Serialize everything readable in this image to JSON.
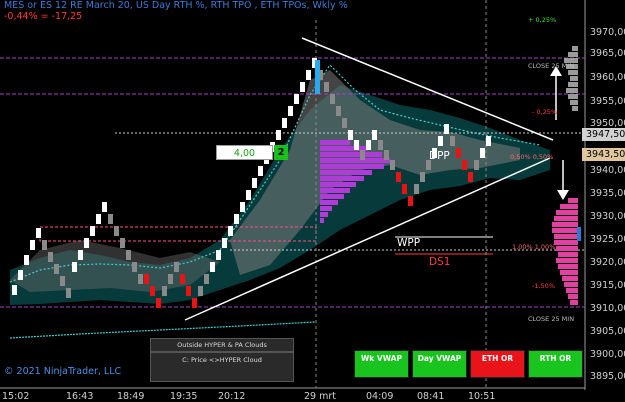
{
  "header": {
    "title": "MES or ES 12 RE March 20, US Day RTH %, RTH TPO , ETH TPOs, Wkly %",
    "change": "-0,44% = -17,25"
  },
  "copyright": "© 2021 NinjaTrader, LLC",
  "y_axis": {
    "ticks": [
      "3970,00",
      "3965,00",
      "3960,00",
      "3955,00",
      "3950,00",
      "3940,00",
      "3935,00",
      "3930,00",
      "3925,00",
      "3920,00",
      "3915,00",
      "3910,00",
      "3905,00",
      "3900,00",
      "3895,00"
    ]
  },
  "x_axis": {
    "ticks": [
      "15:02",
      "16:43",
      "18:49",
      "19:35",
      "20:12",
      "29 mrt",
      "04:09",
      "08:41",
      "10:51"
    ]
  },
  "price_labels": {
    "upper": "3947,50",
    "lower": "3943,50"
  },
  "levels": {
    "pct_top": "+ 0,25%",
    "close_top": "CLOSE 25 MIN",
    "pct_mid_top": "- 0,25%",
    "pct_mid": "- 0,50%",
    "pct_mid_left": "0,50% 0,50%",
    "pct_low": "1,00% 1,00%",
    "pct_bottom": "-1,50%",
    "close_bottom": "CLOSE 25 MIN"
  },
  "labels": {
    "dpp": "DPP",
    "wpp": "WPP",
    "ds1": "DS1"
  },
  "value_box": {
    "value": "4,00",
    "count": "2"
  },
  "hyper": {
    "outside": "Outside HYPER & PA Clouds",
    "price_line1": "C: Price <>HYPER Cloud",
    "price_line2": ""
  },
  "buttons": {
    "wk_vwap": "Wk VWAP",
    "day_vwap": "Day VWAP",
    "eth_or": "ETH OR",
    "rth_or": "RTH OR"
  },
  "colors": {
    "background": "#000000",
    "up_brick": "#ffffff",
    "down_brick": "#e81414",
    "neutral_brick": "#8a8a8a",
    "vwap_cloud": "#0c6b6b",
    "profile": "#b03bd8",
    "price_highlight": "#d2d2d2",
    "lower_price_highlight": "#e0c79e"
  }
}
